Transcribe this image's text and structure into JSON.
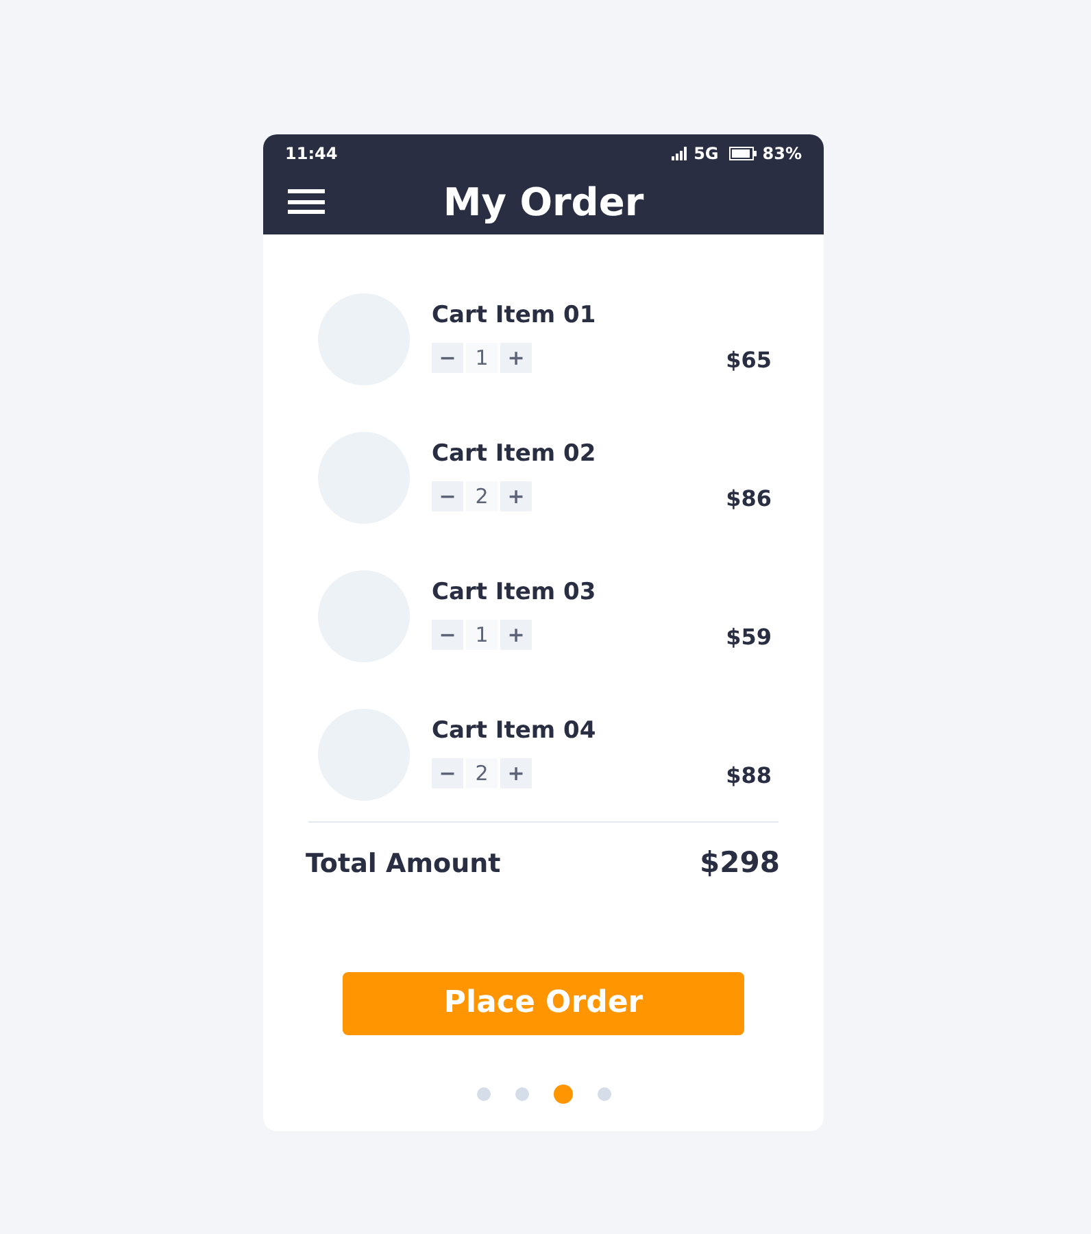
{
  "status_bar": {
    "time": "11:44",
    "network": "5G",
    "battery": "83%"
  },
  "header": {
    "title": "My Order"
  },
  "cart_items": [
    {
      "name": "Cart Item 01",
      "minus": "−",
      "quantity": "1",
      "plus": "+",
      "price": "$65"
    },
    {
      "name": "Cart Item 02",
      "minus": "−",
      "quantity": "2",
      "plus": "+",
      "price": "$86"
    },
    {
      "name": "Cart Item 03",
      "minus": "−",
      "quantity": "1",
      "plus": "+",
      "price": "$59"
    },
    {
      "name": "Cart Item 04",
      "minus": "−",
      "quantity": "2",
      "plus": "+",
      "price": "$88"
    }
  ],
  "total": {
    "label": "Total Amount",
    "value": "$298"
  },
  "button": {
    "label": "Place Order"
  },
  "page_dots": [
    {
      "selected": false
    },
    {
      "selected": false
    },
    {
      "selected": true
    },
    {
      "selected": false
    }
  ]
}
